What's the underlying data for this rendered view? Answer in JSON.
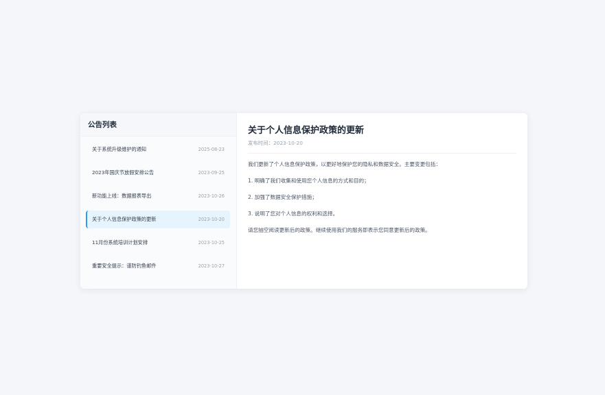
{
  "sidebar": {
    "title": "公告列表",
    "items": [
      {
        "title": "关于系统升级维护的通知",
        "date": "2025-08-23",
        "active": false
      },
      {
        "title": "2023年国庆节放假安排公告",
        "date": "2023-09-25",
        "active": false
      },
      {
        "title": "新功能上线：数据报表导出",
        "date": "2023-10-26",
        "active": false
      },
      {
        "title": "关于个人信息保护政策的更新",
        "date": "2023-10-20",
        "active": true
      },
      {
        "title": "11月份系统培训计划安排",
        "date": "2023-10-25",
        "active": false
      },
      {
        "title": "重要安全提示：谨防钓鱼邮件",
        "date": "2023-10-27",
        "active": false
      }
    ]
  },
  "article": {
    "title": "关于个人信息保护政策的更新",
    "meta": "发布时间：2023-10-20",
    "paragraphs": [
      "我们更新了个人信息保护政策，以更好地保护您的隐私和数据安全。主要变更包括：",
      "1. 明确了我们收集和使用您个人信息的方式和目的；",
      "2. 加强了数据安全保护措施；",
      "3. 说明了您对个人信息的权利和选择。",
      "请您抽空阅读更新后的政策。继续使用我们的服务即表示您同意更新后的政策。"
    ]
  },
  "colors": {
    "accent": "#2b9be8",
    "active_bg": "#e6f4fe",
    "page_bg": "#f4f6fa"
  }
}
